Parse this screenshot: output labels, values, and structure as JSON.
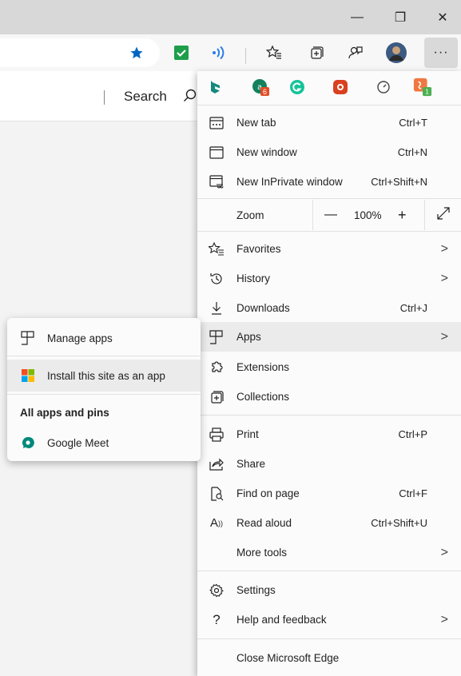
{
  "window": {
    "minimize": "—",
    "restore": "❐",
    "close": "✕"
  },
  "page": {
    "search_label": "Search"
  },
  "menu": {
    "zoom_label": "Zoom",
    "zoom_value": "100%",
    "items": [
      {
        "label": "New tab",
        "shortcut": "Ctrl+T"
      },
      {
        "label": "New window",
        "shortcut": "Ctrl+N"
      },
      {
        "label": "New InPrivate window",
        "shortcut": "Ctrl+Shift+N"
      },
      {
        "label": "Favorites"
      },
      {
        "label": "History"
      },
      {
        "label": "Downloads",
        "shortcut": "Ctrl+J"
      },
      {
        "label": "Apps"
      },
      {
        "label": "Extensions"
      },
      {
        "label": "Collections"
      },
      {
        "label": "Print",
        "shortcut": "Ctrl+P"
      },
      {
        "label": "Share"
      },
      {
        "label": "Find on page",
        "shortcut": "Ctrl+F"
      },
      {
        "label": "Read aloud",
        "shortcut": "Ctrl+Shift+U"
      },
      {
        "label": "More tools"
      },
      {
        "label": "Settings"
      },
      {
        "label": "Help and feedback"
      },
      {
        "label": "Close Microsoft Edge"
      }
    ]
  },
  "submenu": {
    "manage_apps": "Manage apps",
    "install_app": "Install this site as an app",
    "section_heading": "All apps and pins",
    "google_meet": "Google Meet"
  },
  "extensions": {
    "badge_1": "6",
    "badge_2": "1"
  },
  "colors": {
    "accent_blue": "#0067c0",
    "check_green": "#1e9e4a",
    "ext_red": "#e34c26",
    "ext_orange": "#f07840",
    "meet_teal": "#00897b"
  }
}
